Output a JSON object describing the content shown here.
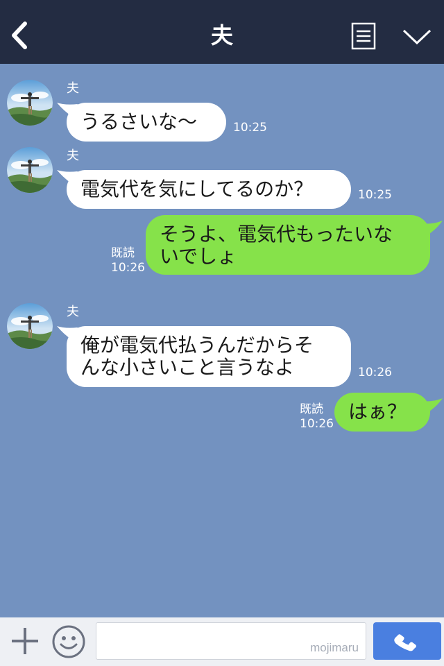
{
  "header": {
    "title": "夫"
  },
  "messages": [
    {
      "sender": "夫",
      "text": "うるさいな〜",
      "time": "10:25"
    },
    {
      "sender": "夫",
      "text": "電気代を気にしてるのか？",
      "time": "10:25"
    },
    {
      "text_lines": [
        "そうよ、電気代もったいな",
        "いでしょ"
      ],
      "read": "既読",
      "time": "10:26"
    },
    {
      "sender": "夫",
      "text_lines": [
        "俺が電気代払うんだからそ",
        "んな小さいこと言うなよ"
      ],
      "time": "10:26"
    },
    {
      "text": "はぁ？",
      "read": "既読",
      "time": "10:26"
    }
  ],
  "input": {
    "placeholder": "",
    "watermark": "mojimaru"
  },
  "colors": {
    "header_bg": "#232c42",
    "chat_bg": "#7392c0",
    "outgoing_bubble": "#86e24a",
    "incoming_bubble": "#ffffff",
    "call_button": "#4a7fe0"
  },
  "icons": [
    "back-chevron-icon",
    "menu-list-icon",
    "collapse-chevron-icon",
    "plus-icon",
    "emoji-icon",
    "phone-icon"
  ]
}
